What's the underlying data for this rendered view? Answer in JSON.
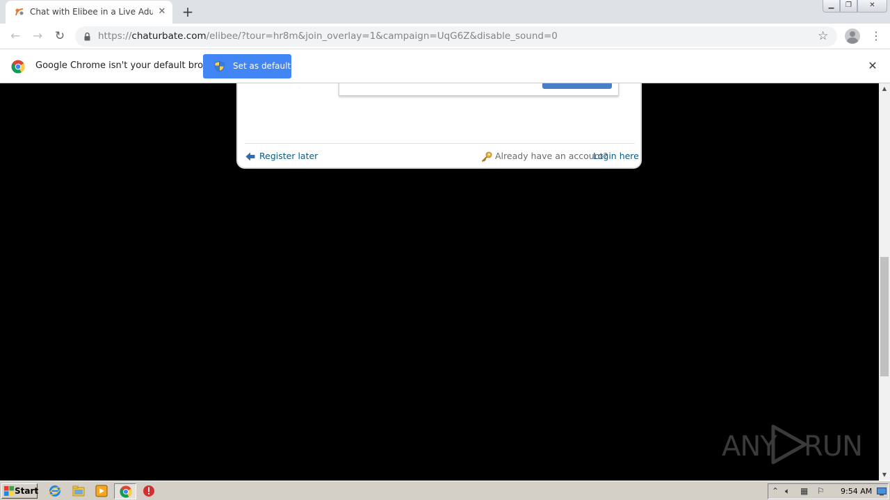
{
  "browser": {
    "tab": {
      "title": "Chat with Elibee in a Live Adult Video Chat Room Now"
    },
    "new_tab_label": "+",
    "url": {
      "scheme": "https://",
      "host": "chaturbate.com",
      "path": "/elibee/?tour=hr8m&join_overlay=1&campaign=UqG6Z&disable_sound=0"
    }
  },
  "infobar": {
    "message": "Google Chrome isn't your default browser",
    "set_default_label": "Set as default"
  },
  "modal": {
    "register_later_label": "Register later",
    "account_prompt": "Already have an account?",
    "login_label": "Login here"
  },
  "watermark": {
    "left": "ANY",
    "right": "RUN"
  },
  "taskbar": {
    "start_label": "Start",
    "clock": "9:54 AM"
  },
  "colors": {
    "page_background": "#000000",
    "link": "#0a5a83",
    "button_blue": "#4285f4"
  }
}
